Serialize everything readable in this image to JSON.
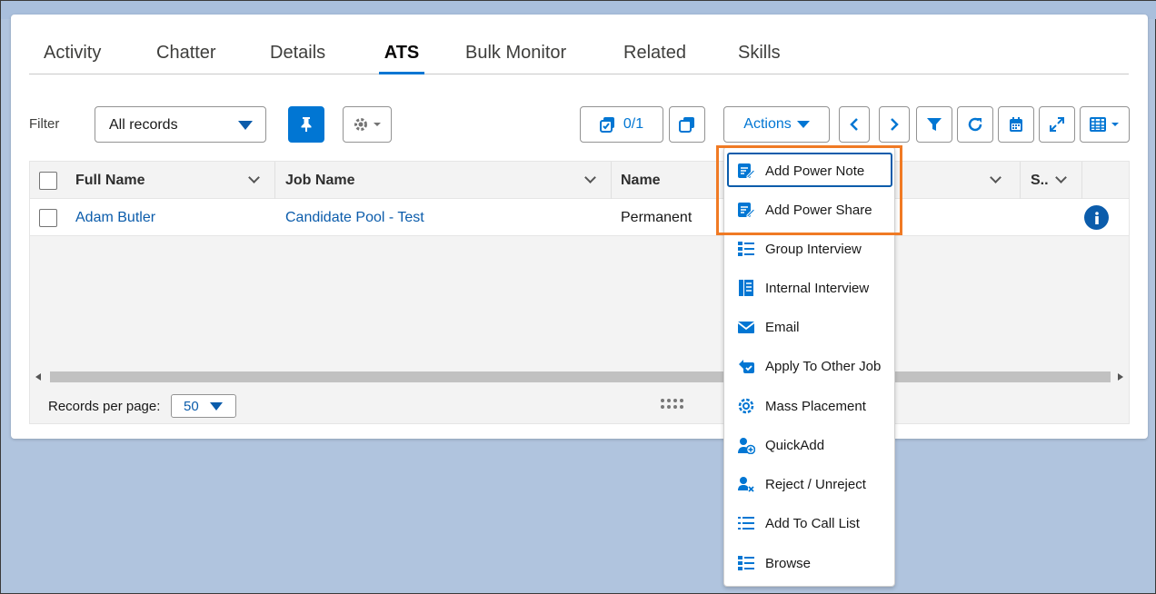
{
  "tabs": [
    {
      "label": "Activity",
      "active": false
    },
    {
      "label": "Chatter",
      "active": false
    },
    {
      "label": "Details",
      "active": false
    },
    {
      "label": "ATS",
      "active": true
    },
    {
      "label": "Bulk Monitor",
      "active": false
    },
    {
      "label": "Related",
      "active": false
    },
    {
      "label": "Skills",
      "active": false
    }
  ],
  "toolbar": {
    "filter_label": "Filter",
    "filter_value": "All records",
    "selection_count": "0/1",
    "actions_label": "Actions"
  },
  "table": {
    "columns": [
      "Full Name",
      "Job Name",
      "Name",
      "S.."
    ],
    "rows": [
      {
        "full_name": "Adam Butler",
        "job_name": "Candidate Pool - Test",
        "name": "Permanent"
      }
    ]
  },
  "footer": {
    "records_per_page_label": "Records per page:",
    "records_per_page_value": "50"
  },
  "actions_menu": [
    {
      "label": "Add Power Note",
      "icon": "power-note-icon"
    },
    {
      "label": "Add Power Share",
      "icon": "power-share-icon"
    },
    {
      "label": "Group Interview",
      "icon": "group-interview-icon"
    },
    {
      "label": "Internal Interview",
      "icon": "internal-interview-icon"
    },
    {
      "label": "Email",
      "icon": "email-icon"
    },
    {
      "label": "Apply To Other Job",
      "icon": "apply-job-icon"
    },
    {
      "label": "Mass Placement",
      "icon": "mass-placement-icon"
    },
    {
      "label": "QuickAdd",
      "icon": "quick-add-icon"
    },
    {
      "label": "Reject / Unreject",
      "icon": "reject-icon"
    },
    {
      "label": "Add To Call List",
      "icon": "call-list-icon"
    },
    {
      "label": "Browse",
      "icon": "browse-icon"
    }
  ],
  "colors": {
    "brand": "#0176d3",
    "link": "#0b5cab",
    "highlight": "#f07a24",
    "background": "#b0c4de"
  }
}
